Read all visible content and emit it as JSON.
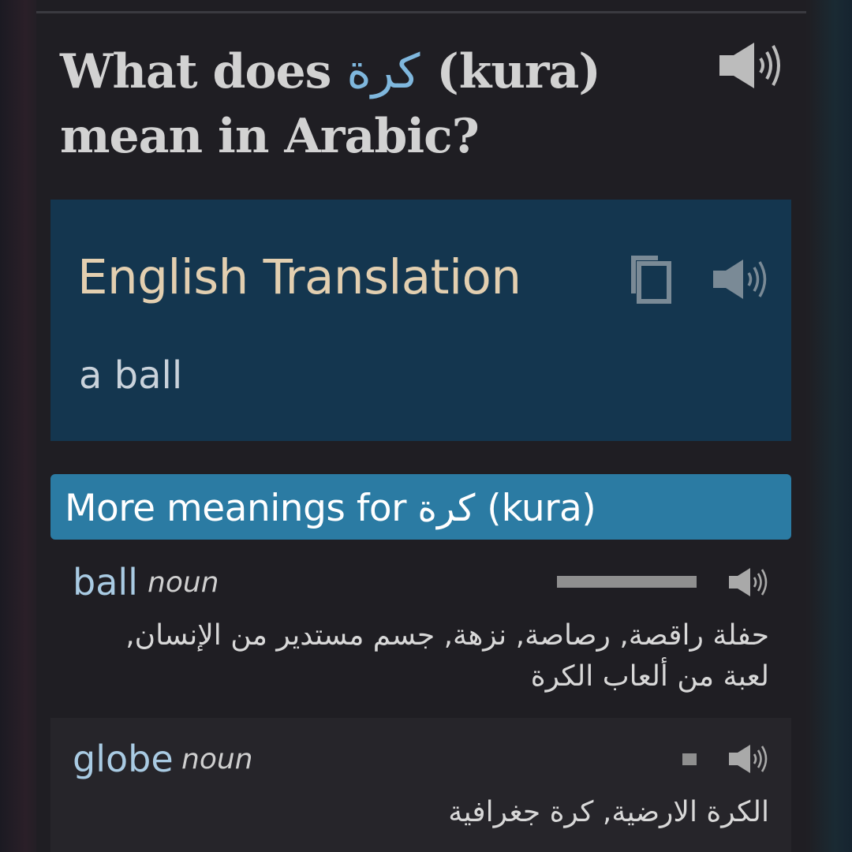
{
  "question": {
    "prefix": "What does",
    "word_arabic": "كرة",
    "suffix_line1": "(kura)",
    "line2": "mean in Arabic?"
  },
  "translation_card": {
    "heading": "English Translation",
    "value": "a ball",
    "icons": [
      "copy-icon",
      "speaker-icon"
    ]
  },
  "more_meanings": {
    "label": "More meanings for كرة (kura)"
  },
  "meanings": [
    {
      "word": "ball",
      "part_of_speech": "noun",
      "frequency": 1.0,
      "definitions": "حفلة راقصة, رصاصة, نزهة, جسم مستدير من الإنسان, لعبة من ألعاب الكرة"
    },
    {
      "word": "globe",
      "part_of_speech": "noun",
      "frequency": 0.1,
      "definitions": "الكرة الارضية, كرة جغرافية"
    }
  ],
  "colors": {
    "panel": "#1f1e23",
    "card": "#14364f",
    "more_bar": "#2b7ba3",
    "heading_tan": "#e3cfb0",
    "arabic_accent": "#7fb7dd",
    "word_blue": "#a9cbe3"
  }
}
